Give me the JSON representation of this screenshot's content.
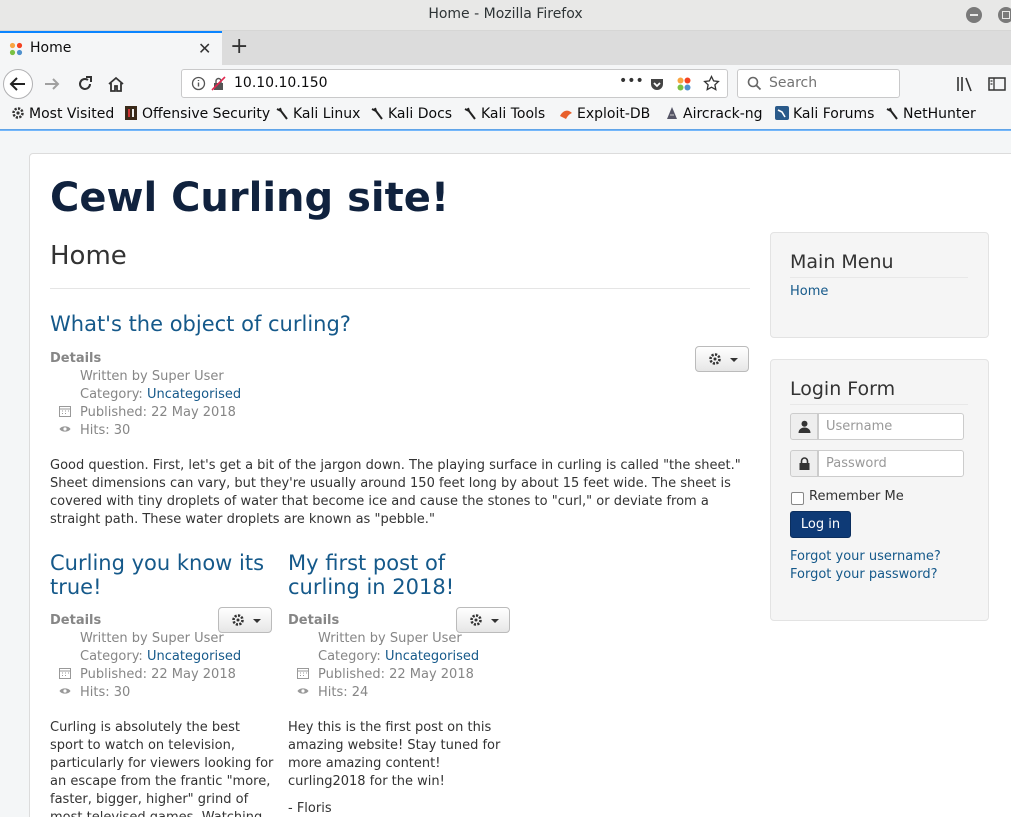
{
  "window": {
    "title": "Home - Mozilla Firefox"
  },
  "tab": {
    "label": "Home",
    "close_glyph": "✕",
    "new_tab_glyph": "+"
  },
  "nav": {
    "url": "10.10.10.150",
    "search_placeholder": "Search",
    "more_glyph": "•••"
  },
  "bookmarks": [
    {
      "label": "Most Visited",
      "icon": "gear-icon"
    },
    {
      "label": "Offensive Security",
      "icon": "offsec-icon"
    },
    {
      "label": "Kali Linux",
      "icon": "kali-dragon-icon"
    },
    {
      "label": "Kali Docs",
      "icon": "kali-dragon-icon"
    },
    {
      "label": "Kali Tools",
      "icon": "kali-dragon-icon"
    },
    {
      "label": "Exploit-DB",
      "icon": "exploitdb-icon"
    },
    {
      "label": "Aircrack-ng",
      "icon": "aircrack-icon"
    },
    {
      "label": "Kali Forums",
      "icon": "kali-forums-icon"
    },
    {
      "label": "NetHunter",
      "icon": "kali-dragon-icon"
    }
  ],
  "site": {
    "title": "Cewl Curling site!",
    "page_heading": "Home"
  },
  "articles": [
    {
      "title": "What's the object of curling?",
      "details": "Details",
      "written_by": "Written by Super User",
      "category_prefix": "Category: ",
      "category": "Uncategorised",
      "published": "Published: 22 May 2018",
      "hits": "Hits: 30",
      "body": "Good question. First, let's get a bit of the jargon down. The playing surface in curling is called \"the sheet.\" Sheet dimensions can vary, but they're usually around 150 feet long by about 15 feet wide. The sheet is covered with tiny droplets of water that become ice and cause the stones to \"curl,\" or deviate from a straight path. These water droplets are known as \"pebble.\""
    },
    {
      "title": "Curling you know its true!",
      "details": "Details",
      "written_by": "Written by Super User",
      "category_prefix": "Category: ",
      "category": "Uncategorised",
      "published": "Published: 22 May 2018",
      "hits": "Hits: 30",
      "body": "Curling is absolutely the best sport to watch on television, particularly for viewers looking for an escape from the frantic \"more, faster, bigger, higher\" grind of most televised games. Watching basketball or hockey can"
    },
    {
      "title": "My first post of curling in 2018!",
      "details": "Details",
      "written_by": "Written by Super User",
      "category_prefix": "Category: ",
      "category": "Uncategorised",
      "published": "Published: 22 May 2018",
      "hits": "Hits: 24",
      "body": "Hey this is the first post on this amazing website! Stay tuned for more amazing content! curling2018 for the win!",
      "signature": "- Floris"
    }
  ],
  "sidebar": {
    "main_menu": {
      "title": "Main Menu",
      "items": [
        "Home"
      ]
    },
    "login": {
      "title": "Login Form",
      "username_placeholder": "Username",
      "password_placeholder": "Password",
      "remember_label": "Remember Me",
      "button_label": "Log in",
      "forgot_username": "Forgot your username?",
      "forgot_password": "Forgot your password?"
    }
  },
  "colors": {
    "link": "#15598a",
    "title": "#10223e",
    "login_button": "#0e3a76",
    "firefox_accent": "#0a84ff"
  }
}
